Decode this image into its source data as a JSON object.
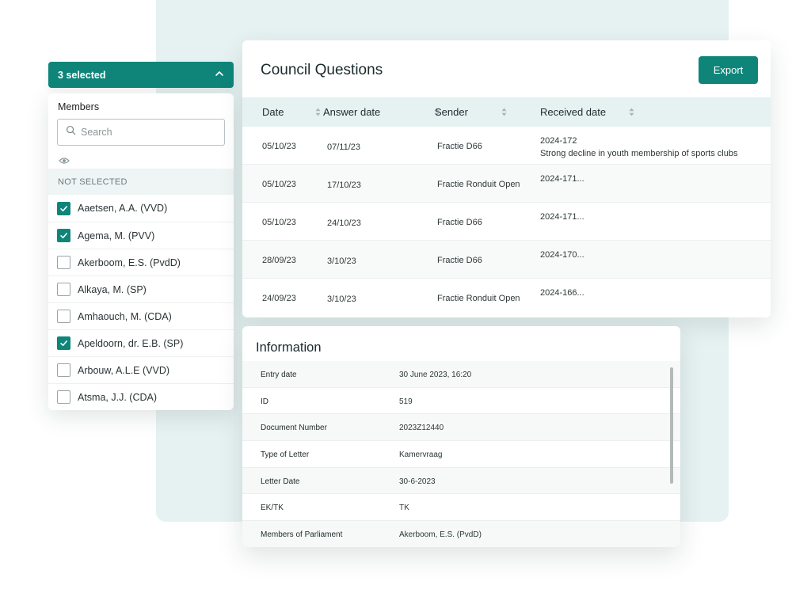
{
  "selector": {
    "header_text": "3 selected",
    "members_label": "Members",
    "search_placeholder": "Search",
    "section_label": "NOT SELECTED",
    "members": [
      {
        "name": "Aaetsen, A.A. (VVD)",
        "checked": true
      },
      {
        "name": "Agema, M. (PVV)",
        "checked": true
      },
      {
        "name": "Akerboom, E.S. (PvdD)",
        "checked": false
      },
      {
        "name": "Alkaya, M. (SP)",
        "checked": false
      },
      {
        "name": "Amhaouch, M. (CDA)",
        "checked": false
      },
      {
        "name": "Apeldoorn, dr. E.B. (SP)",
        "checked": true
      },
      {
        "name": "Arbouw, A.L.E (VVD)",
        "checked": false
      },
      {
        "name": "Atsma, J.J. (CDA)",
        "checked": false
      }
    ]
  },
  "council_questions": {
    "title": "Council Questions",
    "export_label": "Export",
    "columns": [
      "Date",
      "Answer date",
      "Sender",
      "Received date"
    ],
    "rows": [
      {
        "date": "05/10/23",
        "answer_date": "07/11/23",
        "sender": "Fractie D66",
        "received_id": "2024-172",
        "received_desc": "Strong decline in youth membership of sports clubs"
      },
      {
        "date": "05/10/23",
        "answer_date": "17/10/23",
        "sender": "Fractie Ronduit Open",
        "received_id": "2024-171...",
        "received_desc": ""
      },
      {
        "date": "05/10/23",
        "answer_date": "24/10/23",
        "sender": "Fractie D66",
        "received_id": "2024-171...",
        "received_desc": ""
      },
      {
        "date": "28/09/23",
        "answer_date": "3/10/23",
        "sender": "Fractie D66",
        "received_id": "2024-170...",
        "received_desc": ""
      },
      {
        "date": "24/09/23",
        "answer_date": "3/10/23",
        "sender": "Fractie Ronduit Open",
        "received_id": "2024-166...",
        "received_desc": ""
      }
    ]
  },
  "information": {
    "title": "Information",
    "rows": [
      {
        "label": "Entry date",
        "value": "30 June 2023, 16:20"
      },
      {
        "label": "ID",
        "value": "519"
      },
      {
        "label": "Document Number",
        "value": "2023Z12440"
      },
      {
        "label": "Type of Letter",
        "value": "Kamervraag"
      },
      {
        "label": "Letter Date",
        "value": "30-6-2023"
      },
      {
        "label": "EK/TK",
        "value": "TK"
      },
      {
        "label": "Members of Parliament",
        "value": "Akerboom, E.S. (PvdD)"
      }
    ]
  },
  "colors": {
    "accent": "#0f857a",
    "tint": "#e6f2f1",
    "backdrop": "#e6f2f1"
  },
  "icons": {
    "collapse": "chevron-up-icon",
    "search": "search-icon",
    "visibility": "eye-icon",
    "checkbox": "check-icon",
    "sort": "sort-icon"
  }
}
